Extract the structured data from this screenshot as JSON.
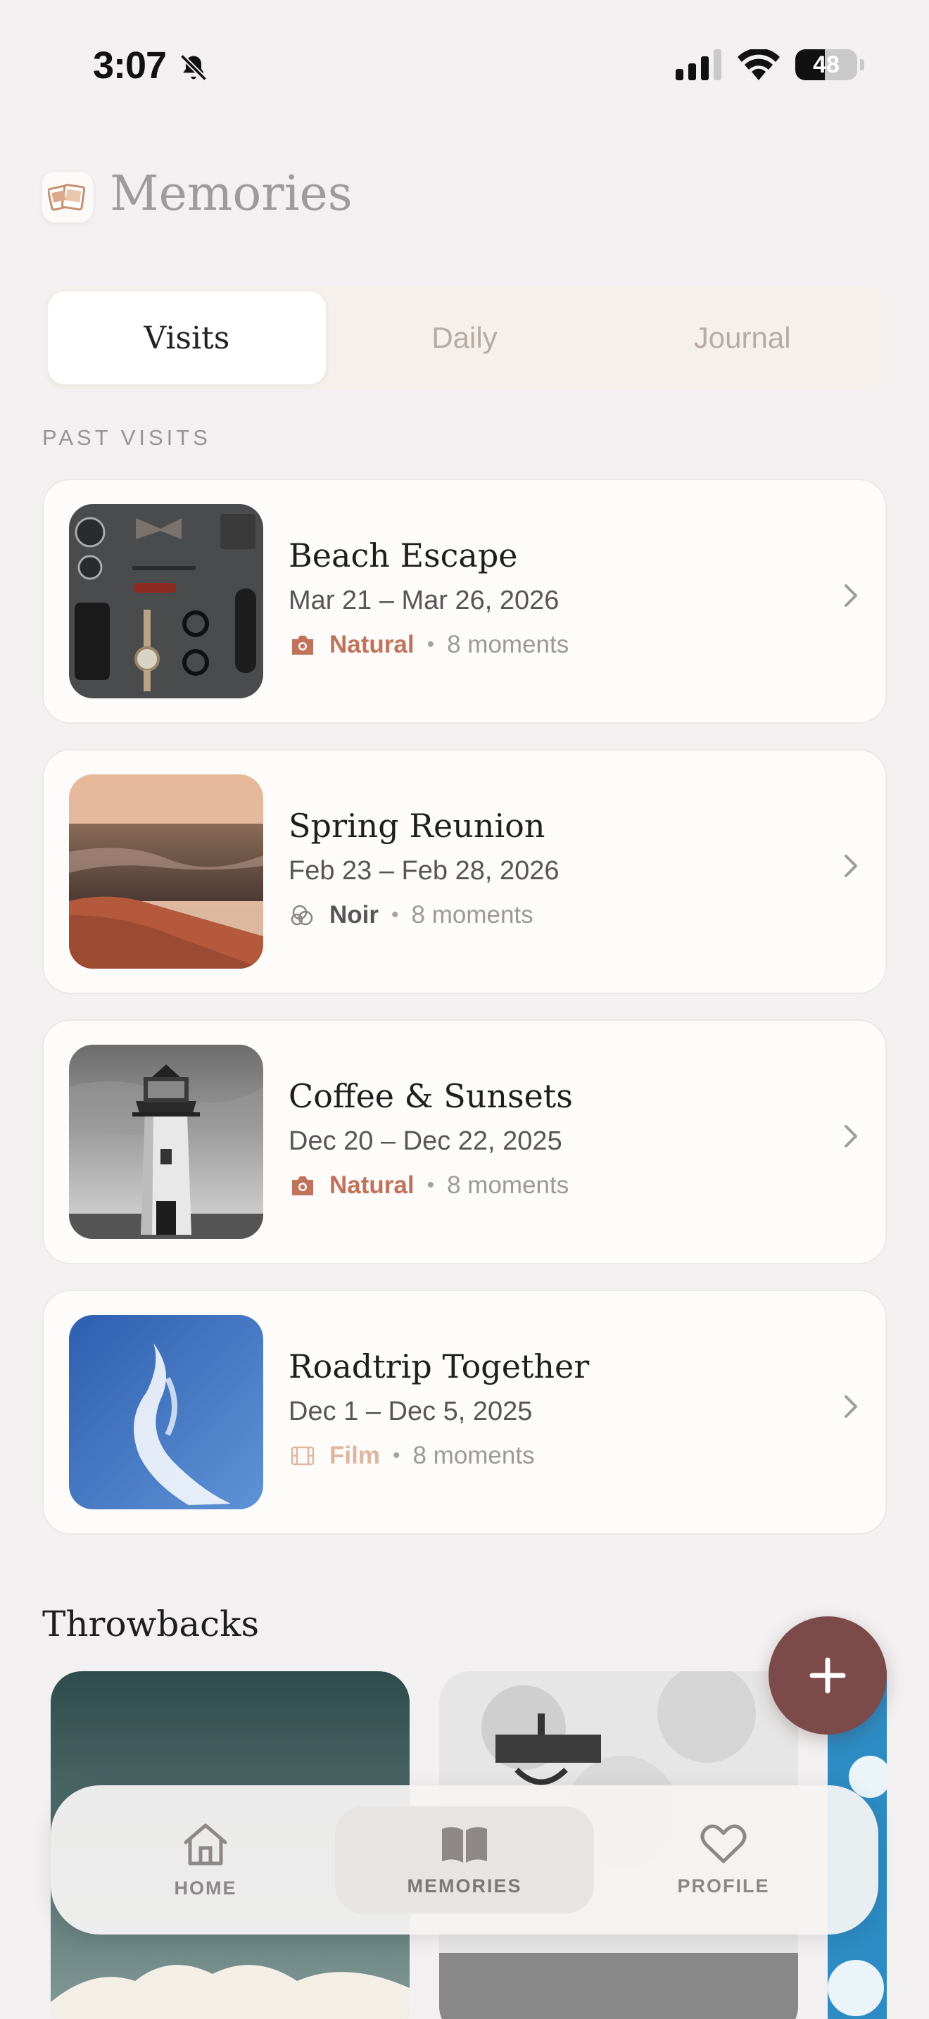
{
  "status_bar": {
    "time": "3:07",
    "battery": "48",
    "battery_level": 0.48
  },
  "header": {
    "title": "Memories",
    "app_icon": "photo-stack-icon"
  },
  "segments": [
    {
      "label": "Visits",
      "active": true
    },
    {
      "label": "Daily",
      "active": false
    },
    {
      "label": "Journal",
      "active": false
    }
  ],
  "section_label": "PAST VISITS",
  "visits": [
    {
      "title": "Beach Escape",
      "dates": "Mar 21 – Mar 26, 2026",
      "filter": "Natural",
      "filter_icon": "camera-icon",
      "filter_color": "#c0735a",
      "moments": "8 moments"
    },
    {
      "title": "Spring Reunion",
      "dates": "Feb 23 – Feb 28, 2026",
      "filter": "Noir",
      "filter_icon": "overlap-circles-icon",
      "filter_color": "#5a5456",
      "moments": "8 moments"
    },
    {
      "title": "Coffee & Sunsets",
      "dates": "Dec 20 – Dec 22, 2025",
      "filter": "Natural",
      "filter_icon": "camera-icon",
      "filter_color": "#c0735a",
      "moments": "8 moments"
    },
    {
      "title": "Roadtrip Together",
      "dates": "Dec 1 – Dec 5, 2025",
      "filter": "Film",
      "filter_icon": "film-icon",
      "filter_color": "#e0b59f",
      "moments": "8 moments"
    }
  ],
  "throwbacks": {
    "title": "Throwbacks"
  },
  "tabbar": [
    {
      "label": "HOME",
      "icon": "house-icon",
      "active": false
    },
    {
      "label": "MEMORIES",
      "icon": "open-book-icon",
      "active": true
    },
    {
      "label": "PROFILE",
      "icon": "heart-icon",
      "active": false
    }
  ],
  "colors": {
    "accent": "#7b4a49",
    "natural": "#c0735a",
    "background": "#f2f0f1"
  }
}
